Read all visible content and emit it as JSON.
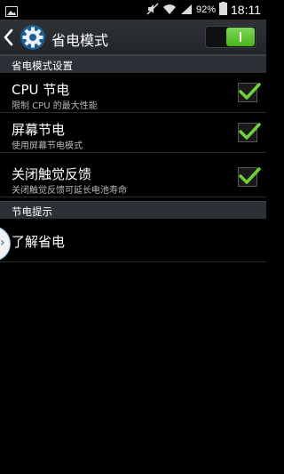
{
  "statusbar": {
    "battery_percent": "92%",
    "time": "18:11"
  },
  "actionbar": {
    "title": "省电模式",
    "toggle_on": true
  },
  "sections": {
    "settings_header": "省电模式设置",
    "tips_header": "节电提示"
  },
  "settings_items": [
    {
      "title": "CPU 节电",
      "subtitle": "限制 CPU 的最大性能",
      "checked": true
    },
    {
      "title": "屏幕节电",
      "subtitle": "使用屏幕节电模式",
      "checked": true
    },
    {
      "title": "关闭触觉反馈",
      "subtitle": "关闭触觉反馈可延长电池寿命",
      "checked": true
    }
  ],
  "tips_item": {
    "title": "了解省电"
  },
  "side_handle": {
    "glyph": "›"
  },
  "colors": {
    "accent_green": "#6fd13a",
    "header_bg": "#2b3136"
  }
}
